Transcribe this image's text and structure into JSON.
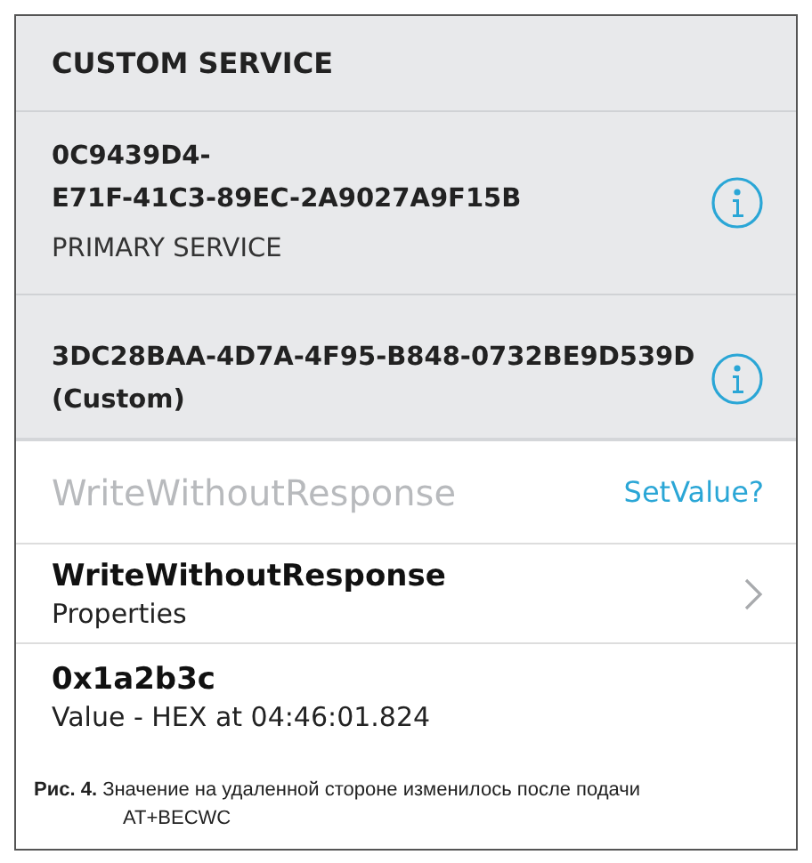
{
  "header": {
    "title": "CUSTOM SERVICE"
  },
  "services": [
    {
      "uuid_lines": [
        "0C9439D4-",
        "E71F-41C3-89EC-2A9027A9F15B"
      ],
      "subtitle": "PRIMARY SERVICE"
    },
    {
      "uuid_lines": [
        "3DC28BAA-4D7A-4F95-B848-0732BE9D539D",
        "(Custom)"
      ]
    }
  ],
  "write_row": {
    "label": "WriteWithoutResponse",
    "action": "SetValue?"
  },
  "properties_row": {
    "title": "WriteWithoutResponse",
    "subtitle": "Properties"
  },
  "value_row": {
    "title": "0x1a2b3c",
    "subtitle": "Value - HEX at 04:46:01.824"
  },
  "caption": "**Рис. 4.** Значение на удаленной стороне изменилось после подачи AT+BECWC"
}
